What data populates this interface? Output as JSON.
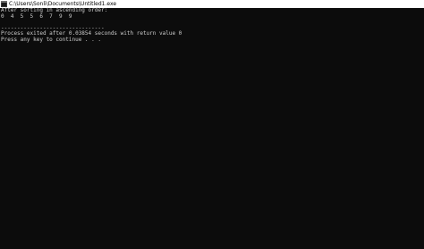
{
  "window": {
    "title": "C:\\Users\\Sonli\\Documents\\Untitled1.exe",
    "icon": "console-app-icon"
  },
  "console": {
    "lines": [
      "After sorting in ascending order:",
      "0  4  5  5  6  7  9  9",
      "",
      "--------------------------------",
      "Process exited after 0.03854 seconds with return value 0",
      "Press any key to continue . . ."
    ]
  },
  "colors": {
    "background": "#0c0c0c",
    "text": "#cccccc",
    "titlebar": "#ffffff"
  }
}
